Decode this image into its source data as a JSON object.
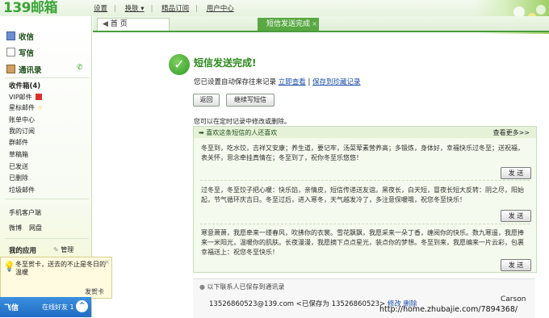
{
  "app": {
    "logo": "139邮箱"
  },
  "topnav": [
    {
      "label": "设置"
    },
    {
      "label": "换肤 ▾"
    },
    {
      "label": "精品订阅"
    },
    {
      "label": "用户中心"
    }
  ],
  "tabs": {
    "home": "首 页",
    "sms": "短信发送完成",
    "close": "×"
  },
  "sidebar": {
    "inbox": "收信",
    "compose": "写信",
    "contacts": "通讯录",
    "inbox_folder": "收件箱(4)",
    "folders": [
      "VIP邮件",
      "星标邮件",
      "账单中心",
      "我的订阅",
      "群邮件",
      "草稿箱",
      "已发送",
      "已删除",
      "垃圾邮件"
    ],
    "client": "手机客户端",
    "weibo": "微博",
    "netdisk": "网盘",
    "apps": "我的应用",
    "manage": "管理"
  },
  "popup": {
    "message": "冬至贺卡，送去的不止是冬日的温暖",
    "link": "发贺卡",
    "close": "×"
  },
  "feixin": {
    "label": "飞信",
    "friends": "在线好友 1",
    "arrow": "^"
  },
  "main": {
    "title": "短信发送完成!",
    "info_prefix": "您已设置自动保存往来记录",
    "view_now": "立即查看",
    "separator": "|",
    "save_record": "保存到珍藏记录",
    "back_button": "返回",
    "continue_button": "继续写短信",
    "hint": "您可以在定时记录中修改或删除。",
    "panel_title": "喜欢这条短信的人还喜欢",
    "more": "查看更多>>",
    "send_label": "发 送",
    "greetings": [
      "冬至到，吃水饺，吉祥又安康；养生道，要记牢，汤菜荤素营养高；多锻炼，身体好，幸福快乐过冬至；送祝福，表关怀，思念牵挂真情在；冬至到了，祝你冬至乐悠悠！",
      "过冬至，冬至饺子把心暖：快乐馅，亲情皮，短信传递送友谊。黑夜长，白天短，冒夜长短大反转：阴之尽，阳始起，节气循环庆吉日。冬至过后，进入寒冬，天气越发冷了，多注意保暖哦，祝您冬至快乐！",
      "寒意萧萧，我愿牵来一缕春风，吹拂你的衣裳。雪花飘飘，我愿采来一朵丁香，缠阅你的快乐。数九寒遥，我愿捧来一米阳光，温暖你的肌肤。长夜漫漫，我愿摘下点点星光，装点你的梦想。冬至到来，我愿编来一片云彩，包裹幸福送上：祝您冬至快乐！"
    ],
    "contacts_header": "以下联系人已保存到通讯录",
    "contact_row": "13526860523@139.com <已保存为 13526860523>",
    "edit": "修改",
    "delete": "删除"
  },
  "overlay": {
    "carson": "Carson",
    "watermark": "http://home.zhubajie.com/7894368/"
  }
}
